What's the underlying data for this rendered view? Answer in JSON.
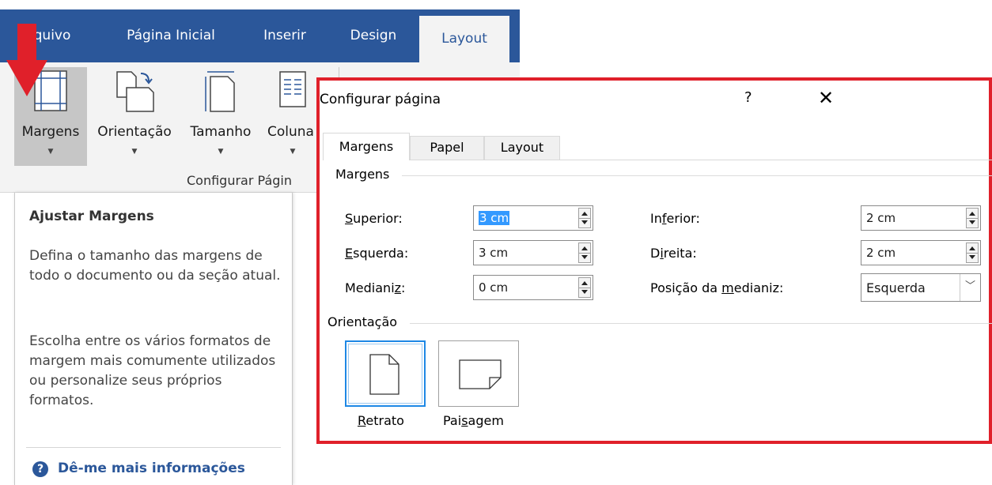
{
  "ribbon": {
    "tabs": [
      {
        "label": "quivo"
      },
      {
        "label": "Página Inicial"
      },
      {
        "label": "Inserir"
      },
      {
        "label": "Design"
      },
      {
        "label": "Layout"
      }
    ],
    "buttons": [
      {
        "label": "Margens"
      },
      {
        "label": "Orientação"
      },
      {
        "label": "Tamanho"
      },
      {
        "label": "Coluna"
      }
    ],
    "group_label": "Configurar Págin",
    "accent": "#2b579a"
  },
  "tooltip": {
    "title": "Ajustar Margens",
    "paragraph1": "Defina o tamanho das margens de todo o documento ou da seção atual.",
    "paragraph2": "Escolha entre os vários formatos de margem mais comumente utilizados ou personalize seus próprios formatos.",
    "help_icon": "?",
    "help_link": "Dê-me mais informações"
  },
  "dialog": {
    "title": "Configurar página",
    "help_btn": "?",
    "close_btn": "✕",
    "tabs": [
      {
        "label": "Margens"
      },
      {
        "label": "Papel"
      },
      {
        "label": "Layout"
      }
    ],
    "section_margins": "Margens",
    "fields": {
      "top": {
        "label_pre": "",
        "label_ul": "S",
        "label_post": "uperior:",
        "value": "3 cm"
      },
      "left": {
        "label_pre": "",
        "label_ul": "E",
        "label_post": "squerda:",
        "value": "3 cm"
      },
      "gutter": {
        "label_pre": "Mediani",
        "label_ul": "z",
        "label_post": ":",
        "value": "0 cm"
      },
      "bottom": {
        "label_pre": "In",
        "label_ul": "f",
        "label_post": "erior:",
        "value": "2 cm"
      },
      "right": {
        "label_pre": "D",
        "label_ul": "i",
        "label_post": "reita:",
        "value": "2 cm"
      },
      "gutter_pos": {
        "label_pre": "Posição da ",
        "label_ul": "m",
        "label_post": "edianiz:",
        "value": "Esquerda"
      }
    },
    "section_orientation": "Orientação",
    "orientation": {
      "portrait": {
        "label_pre": "",
        "label_ul": "R",
        "label_post": "etrato"
      },
      "landscape": {
        "label_pre": "Pai",
        "label_ul": "s",
        "label_post": "agem"
      }
    },
    "highlight_border": "#e0202a"
  }
}
